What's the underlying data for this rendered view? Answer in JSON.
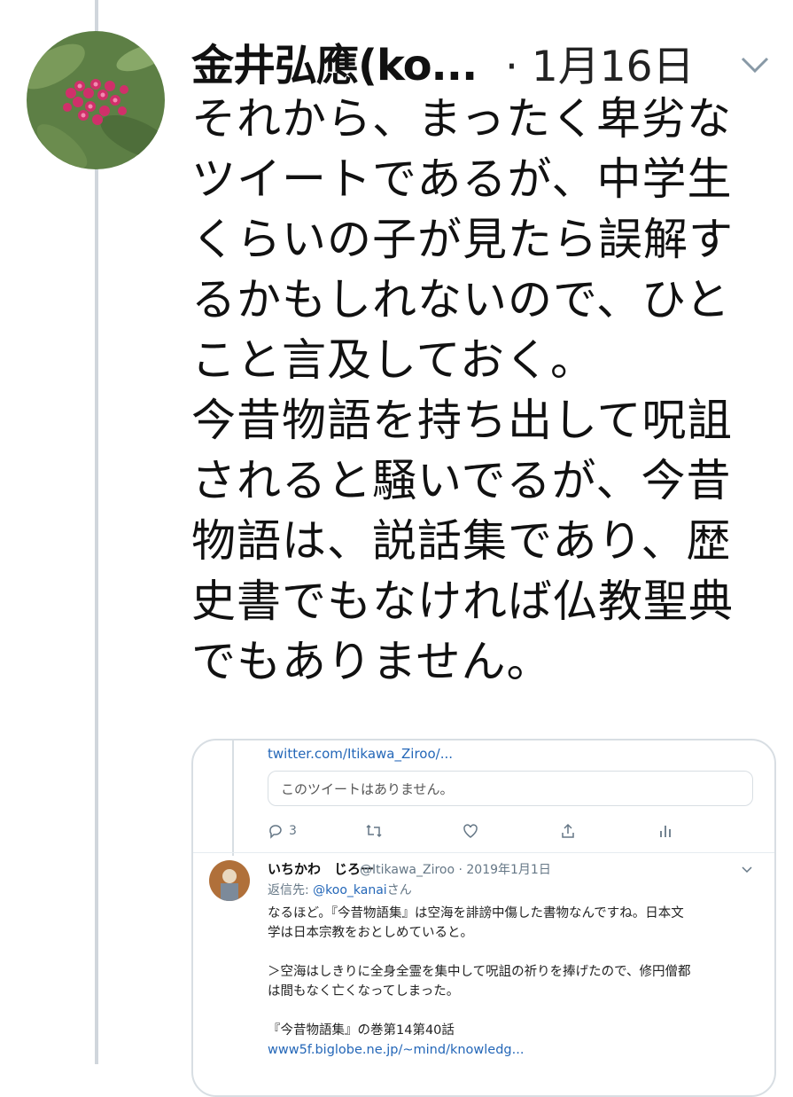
{
  "tweet": {
    "author": "金井弘應(ko...",
    "date": "· 1月16日",
    "body": "それから、まったく卑劣な\nツイートであるが、中学生\nくらいの子が見たら誤解す\nるかもしれないので、ひと\nこと言及しておく。\n今昔物語を持ち出して呪詛\nされると騒いでるが、今昔\n物語は、説話集であり、歴\n史書でもなければ仏教聖典\nでもありません。"
  },
  "embed": {
    "top_link": "twitter.com/Itikawa_Ziroo/...",
    "quoted_unavailable": "このツイートはありません。",
    "reply_count": "3",
    "tweet": {
      "name": "いちかわ　じろー",
      "handle_date": "@Itikawa_Ziroo · 2019年1月1日",
      "reply_prefix": "返信先: ",
      "reply_to": "@koo_kanai",
      "reply_suffix": "さん",
      "text": "なるほど。『今昔物語集』は空海を誹謗中傷した書物なんですね。日本文\n学は日本宗教をおとしめていると。\n\n＞空海はしきりに全身全霊を集中して呪詛の祈りを捧げたので、修円僧都\nは間もなく亡くなってしまった。\n\n『今昔物語集』の巻第14第40話",
      "url": "www5f.biglobe.ne.jp/~mind/knowledg..."
    }
  },
  "colors": {
    "link": "#2467b8",
    "thread_line": "#d0d6dc",
    "muted": "#657786",
    "flower": "#d0306a"
  },
  "icons": [
    "chevron-down-icon",
    "reply-icon",
    "retweet-icon",
    "like-icon",
    "share-icon",
    "analytics-icon"
  ]
}
